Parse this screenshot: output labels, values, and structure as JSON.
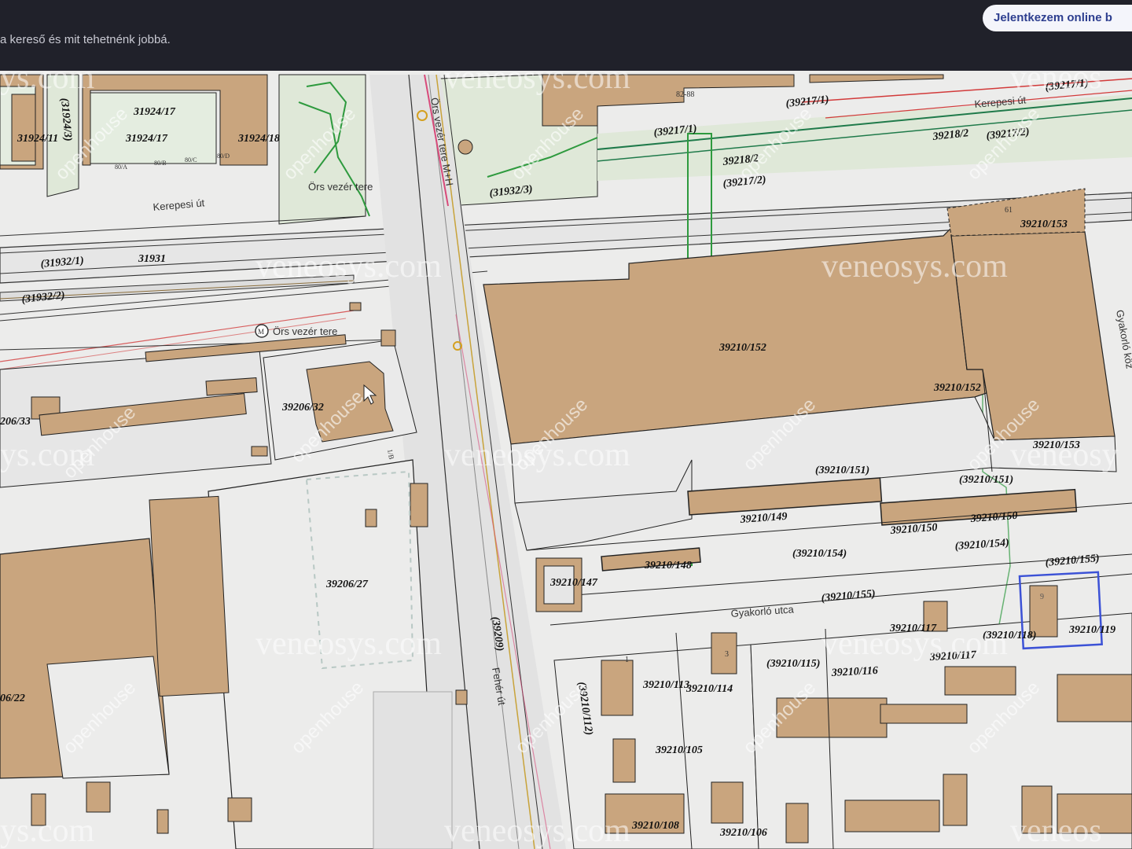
{
  "header": {
    "feedback_text": "a kereső és mit tehetnénk jobbá.",
    "login_button": "Jelentkezem online b"
  },
  "map": {
    "watermark": "veneosys.com",
    "watermark_left": "ys.com",
    "watermark_right": "veneos",
    "watermark_right2": "veneosy",
    "logo_text": "openhouse",
    "streets": {
      "kerepesi_ut": "Kerepesi út",
      "kerepesi_ut_right": "Kerepesi út",
      "ors_vezer_tere": "Örs vezér tere",
      "ors_vezer_tere_metro": "Örs vezér tere",
      "gyakorlo_utca": "Gyakorló utca",
      "gyakorlo_koz": "Gyakorló köz",
      "feher_ut": "Fehér út",
      "ors_station": "Örs vezér tere M+H"
    },
    "lots": {
      "l31924_17a": "31924/17",
      "l31924_17b": "31924/17",
      "l31924_18": "31924/18",
      "l31924_11": "31924/11",
      "l31924_3": "(31924/3)",
      "l31932_1": "(31932/1)",
      "l31931": "31931",
      "l31932_2": "(31932/2)",
      "l31932_3": "(31932/3)",
      "l39217_1a": "(39217/1)",
      "l39217_1b": "(39217/1)",
      "l39217_1c": "(39217/1)",
      "l39218_2a": "39218/2",
      "l39217_2a": "(39217/2)",
      "l39218_2b": "39218/2",
      "l39217_2b": "(39217/2)",
      "l39210_153a": "39210/153",
      "l39210_152a": "39210/152",
      "l39210_152b": "39210/152",
      "l39210_153b": "39210/153",
      "l39210_151a": "(39210/151)",
      "l39210_151b": "(39210/151)",
      "l39210_149": "39210/149",
      "l39210_150a": "39210/150",
      "l39210_150b": "39210/150",
      "l39210_154a": "(39210/154)",
      "l39210_154b": "(39210/154)",
      "l39210_148": "39210/148",
      "l39210_147": "39210/147",
      "l39210_155a": "(39210/155)",
      "l39210_155b": "(39210/155)",
      "l39206_32": "39206/32",
      "l206_33": "206/33",
      "l39206_27": "39206/27",
      "l06_22": "06/22",
      "l39209": "(39209)",
      "l39210_117a": "39210/117",
      "l39210_118": "(39210/118)",
      "l39210_119": "39210/119",
      "l39210_117b": "39210/117",
      "l39210_115": "(39210/115)",
      "l39210_116": "39210/116",
      "l39210_113": "39210/113",
      "l39210_114": "39210/114",
      "l39210_112": "(39210/112)",
      "l39210_105": "39210/105",
      "l39210_108": "39210/108",
      "l39210_106": "39210/106"
    },
    "house_numbers": {
      "n82_88": "82-88",
      "n61": "61",
      "n80a": "80/A",
      "n80b": "80/B",
      "n80c": "80/C",
      "n80d": "80/D",
      "n1": "1",
      "n3": "3",
      "n1_b": "1/B",
      "n9": "9"
    },
    "colors": {
      "building": "#c9a57e",
      "background": "#ececeb",
      "green_paths": "#2e9a3e",
      "rail_red": "#d23a3a",
      "selection": "#3c52d6"
    }
  }
}
